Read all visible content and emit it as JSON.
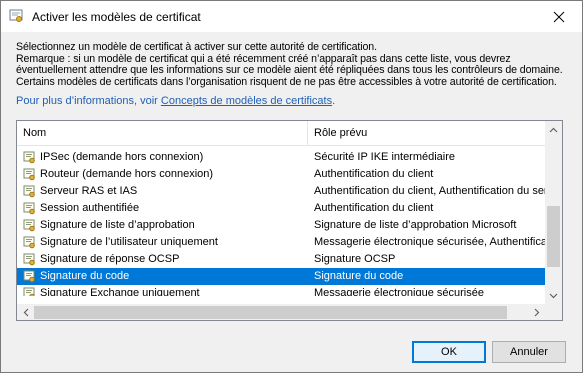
{
  "window": {
    "title": "Activer les modèles de certificat"
  },
  "description": {
    "lines": [
      "Sélectionnez un modèle de certificat à activer sur cette autorité de certification.",
      "Remarque : si un modèle de certificat qui a été récemment créé n’apparaît pas dans cette liste, vous devrez",
      "éventuellement attendre que les informations sur ce modèle aient été répliquées dans tous les contrôleurs de domaine.",
      "Certains modèles de certificats dans l’organisation risquent de ne pas être accessibles à votre autorité de certification."
    ],
    "link_prefix": "Pour plus d’informations, voir ",
    "link_text": "Concepts de modèles de certificats",
    "link_suffix": "."
  },
  "list": {
    "columns": [
      "Nom",
      "Rôle prévu"
    ],
    "rows": [
      {
        "name": "IPSec (demande hors connexion)",
        "role": "Sécurité IP IKE intermédiaire",
        "selected": false
      },
      {
        "name": "Routeur (demande hors connexion)",
        "role": "Authentification du client",
        "selected": false
      },
      {
        "name": "Serveur RAS et IAS",
        "role": "Authentification du client, Authentification du serv",
        "selected": false
      },
      {
        "name": "Session authentifiée",
        "role": "Authentification du client",
        "selected": false
      },
      {
        "name": "Signature de liste d’approbation",
        "role": "Signature de liste d’approbation Microsoft",
        "selected": false
      },
      {
        "name": "Signature de l’utilisateur uniquement",
        "role": "Messagerie électronique sécurisée, Authentificati",
        "selected": false
      },
      {
        "name": "Signature de réponse OCSP",
        "role": "Signature OCSP",
        "selected": false
      },
      {
        "name": "Signature du code",
        "role": "Signature du code",
        "selected": true
      },
      {
        "name": "Signature Exchange uniquement",
        "role": "Messagerie électronique sécurisée",
        "selected": false
      }
    ]
  },
  "buttons": {
    "ok": "OK",
    "cancel": "Annuler"
  },
  "colors": {
    "selection": "#0078d7",
    "link": "#1f5fb5"
  },
  "icons": {
    "app": "certificate-icon",
    "close": "close-icon",
    "row": "certificate-template-icon"
  }
}
